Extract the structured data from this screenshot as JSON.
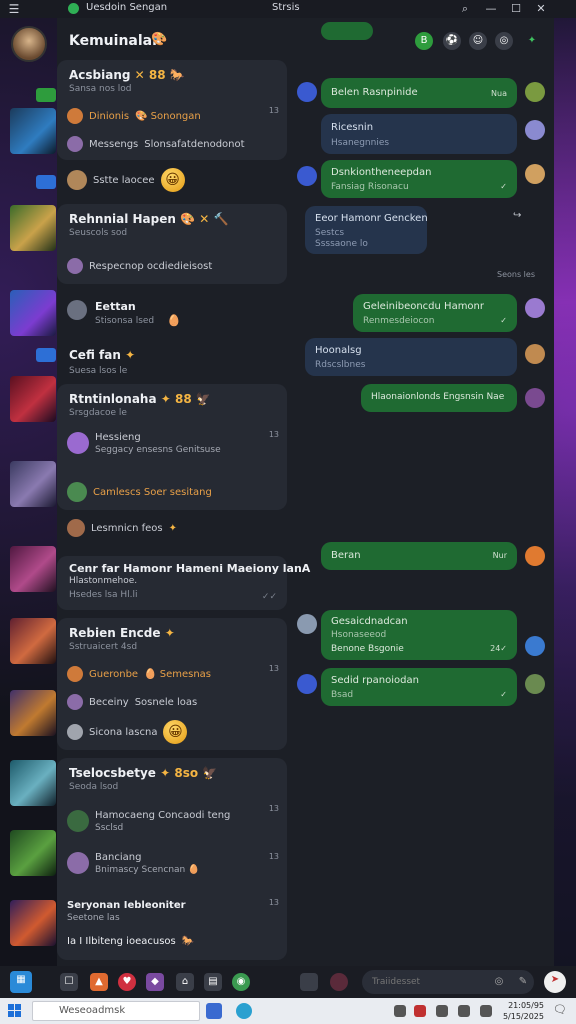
{
  "window": {
    "menu_icon": "☰",
    "title": "Uesdoin Sengan",
    "center_label": "Strsis",
    "controls": {
      "search": "⌕",
      "minimize": "—",
      "maximize": "☐",
      "close": "✕"
    }
  },
  "header": {
    "title": "Kemuinalan",
    "emoji": "🎨",
    "buttons": [
      "B",
      "⚽",
      "☺",
      "◎",
      "✦"
    ]
  },
  "left_cards": [
    {
      "title": "Acsbiang",
      "title_extra": "✕ 88 🐎",
      "sub": "Sansa nos lod",
      "rows": [
        {
          "text": "Dinionis",
          "extra": "🎨 Sonongan",
          "style": "orange",
          "count": "13"
        },
        {
          "text": "Messengs",
          "extra": "Slonsafatdenodonot",
          "style": "plain"
        },
        {
          "text": "Sstte laocee",
          "emoji": "😀",
          "style": "plain"
        }
      ]
    },
    {
      "title": "Rehnnial Hapen",
      "title_extra": "🎨 ✕ 🔨",
      "sub": "Seuscols sod",
      "rows": [
        {
          "text": "Respecnop ocdiedieisost",
          "style": "plain"
        }
      ]
    },
    {
      "title": "Eettan",
      "sub": "Stisonsa lsed",
      "emoji": "🥚",
      "plain": true
    },
    {
      "title": "Cefi fan",
      "title_extra": "✦",
      "sub": "Suesa lsos le",
      "plain": true
    },
    {
      "title": "Rtntinlonaha",
      "title_extra": "✦ 88 🦅",
      "sub": "Srsgdacoe le",
      "rows": [
        {
          "text": "Hessieng",
          "extra": "Seggacy ensesns Genitsuse",
          "style": "plain",
          "count": "13"
        },
        {
          "text": "Camlescs Soer sesitang",
          "style": "orange"
        }
      ]
    },
    {
      "title": "Lesmnicn feos",
      "title_extra": "✦",
      "plain": true,
      "avatar_row": true
    },
    {
      "title": "Cenr far Hamonr Hameni Maeiony lanA",
      "sub": "Hlastonmehoe.",
      "sub2": "Hsedes lsa Hl.li",
      "ticks": "✓✓"
    },
    {
      "title": "Rebien Encde",
      "title_extra": "✦",
      "sub": "Sstruaicert 4sd",
      "rows": [
        {
          "text": "Gueronbe",
          "extra": "🥚 Semesnas",
          "style": "orange",
          "count": "13"
        },
        {
          "text": "Beceiny",
          "extra": "Sosnele loas",
          "style": "plain"
        },
        {
          "text": "Sicona lascna",
          "emoji": "😀",
          "style": "plain"
        }
      ]
    },
    {
      "title": "Tselocsbetye",
      "title_extra": "✦ 8so 🦅",
      "sub": "Seoda lsod",
      "rows": [
        {
          "text": "Hamocaeng Concaodi teng",
          "extra": "Ssclsd",
          "style": "plain",
          "count": "13"
        },
        {
          "text": "Banciang",
          "extra": "Bnimascy Scencnan",
          "emoji_small": "🥚",
          "style": "plain",
          "count": "13"
        },
        {
          "text": "Seryonan Iebleoniter",
          "extra": "Seetone las",
          "style": "plain",
          "count": "13"
        },
        {
          "text": "Ia I Ilbiteng ioeacusos",
          "emoji_small": "🐎",
          "style": "plain"
        }
      ]
    }
  ],
  "messages": [
    {
      "text": "Belen Rasnpinide",
      "meta": "Nua",
      "style": "green"
    },
    {
      "text": "Ricesnin",
      "sub": "Hsanegnnies",
      "style": "blue"
    },
    {
      "text": "Dsnkiontheneepdan",
      "sub": "Fansiag Risonacu",
      "meta": "✓",
      "style": "green"
    },
    {
      "text": "Eeor Hamonr Gencken",
      "sub": "Sestcs",
      "sub2": "Ssssaone lo",
      "style": "blue"
    },
    {
      "text": "Seons les",
      "style": "time"
    },
    {
      "text": "Geleinibeoncdu Hamonr",
      "sub": "Renmesdeiocon",
      "meta": "✓",
      "style": "green"
    },
    {
      "text": "Hoonalsg",
      "sub": "Rdscslbnes",
      "style": "blue"
    },
    {
      "text": "Hlaonaionlonds Engsnsin Nae",
      "style": "green"
    },
    {
      "text": "Beran",
      "meta": "Nur",
      "style": "green"
    },
    {
      "text": "Gesaicdnadcan",
      "sub": "Hsonaseeod",
      "sub2": "Benone Bsgonie",
      "meta": "24✓",
      "style": "green"
    },
    {
      "text": "Sedid rpanoiodan",
      "sub": "Bsad",
      "meta": "✓",
      "style": "green"
    }
  ],
  "bottom": {
    "input_placeholder": "Traiidesset",
    "icons": [
      "▦",
      "☐",
      "▲",
      "♥",
      "◆",
      "⌂",
      "▤",
      "◉"
    ]
  },
  "taskbar": {
    "search_placeholder": "Weseoadmsk",
    "clock_time": "21:05/95",
    "clock_date": "5/15/2025",
    "notif_icon": "🗨"
  },
  "colors": {
    "accent_green": "#1f6a32",
    "accent_blue": "#25344c",
    "card_bg": "#262a33",
    "window_bg": "#1c1f26"
  }
}
